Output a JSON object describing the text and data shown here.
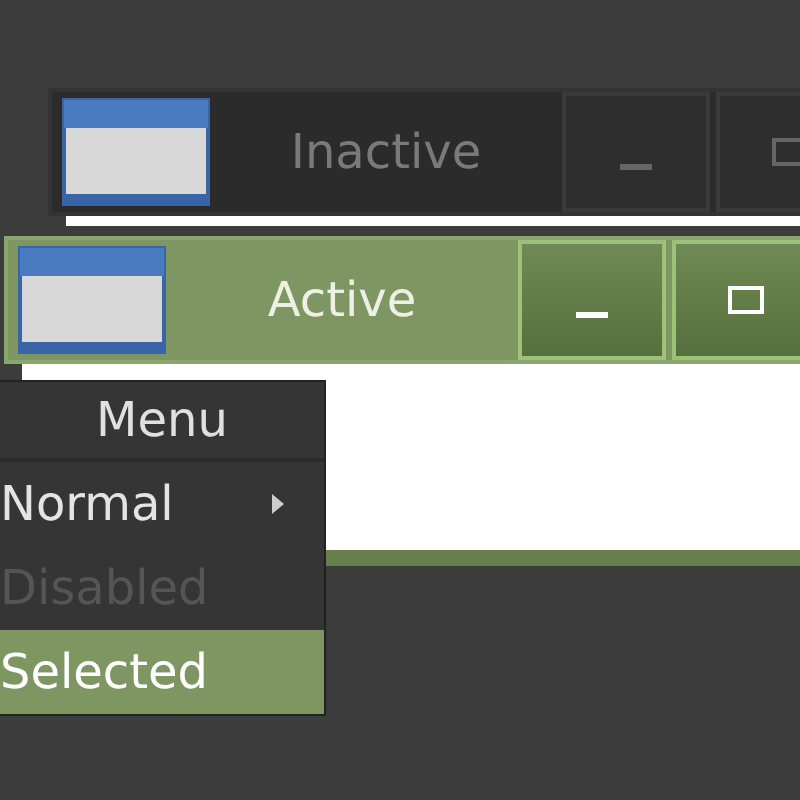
{
  "windows": [
    {
      "title": "Inactive",
      "active": false
    },
    {
      "title": "Active",
      "active": true
    }
  ],
  "menu": {
    "title": "Menu",
    "items": [
      {
        "label": "Normal",
        "disabled": false,
        "selected": false,
        "submenu": true
      },
      {
        "label": "Disabled",
        "disabled": true,
        "selected": false,
        "submenu": false
      },
      {
        "label": "Selected",
        "disabled": false,
        "selected": true,
        "submenu": false
      }
    ]
  }
}
